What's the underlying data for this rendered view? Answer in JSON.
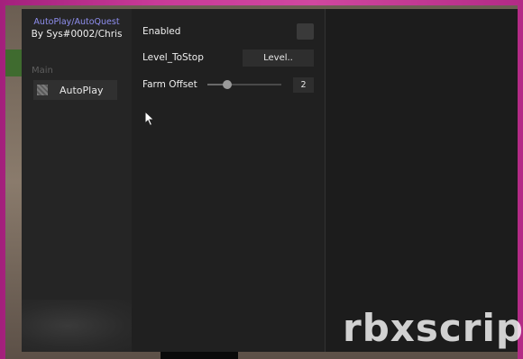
{
  "window": {
    "title_line1": "AutoPlay/AutoQuest",
    "title_line2": "By Sys#0002/Chris"
  },
  "sidebar": {
    "section_label": "Main",
    "items": [
      {
        "label": "AutoPlay",
        "icon": "tab-icon"
      }
    ]
  },
  "settings": {
    "enabled": {
      "label": "Enabled",
      "checked": false
    },
    "level_to_stop": {
      "label": "Level_ToStop",
      "value": "Level.."
    },
    "farm_offset": {
      "label": "Farm Offset",
      "value": "2",
      "slider_fraction": 0.27
    }
  },
  "watermark": "rbxscrip",
  "colors": {
    "accent_title": "#8f8ff0",
    "background_frame": "#c93a98"
  }
}
